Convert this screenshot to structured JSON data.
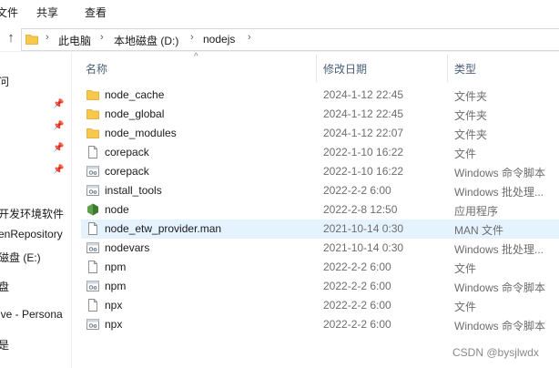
{
  "ribbon": {
    "tabs": [
      "文件",
      "共享",
      "查看"
    ]
  },
  "address": {
    "crumbs": [
      "此电脑",
      "本地磁盘 (D:)",
      "nodejs"
    ]
  },
  "nav": {
    "items": [
      "问",
      "开发环境软件",
      "enRepository",
      "磁盘 (E:)",
      "盘",
      "ive - Persona",
      "是"
    ]
  },
  "columns": {
    "name": "名称",
    "date": "修改日期",
    "type": "类型"
  },
  "files": [
    {
      "name": "node_cache",
      "date": "2024-1-12 22:45",
      "type": "文件夹",
      "icon": "folder-icon"
    },
    {
      "name": "node_global",
      "date": "2024-1-12 22:45",
      "type": "文件夹",
      "icon": "folder-icon"
    },
    {
      "name": "node_modules",
      "date": "2024-1-12 22:07",
      "type": "文件夹",
      "icon": "folder-icon"
    },
    {
      "name": "corepack",
      "date": "2022-1-10 16:22",
      "type": "文件",
      "icon": "file-icon"
    },
    {
      "name": "corepack",
      "date": "2022-1-10 16:22",
      "type": "Windows 命令脚本",
      "icon": "script-icon"
    },
    {
      "name": "install_tools",
      "date": "2022-2-2 6:00",
      "type": "Windows 批处理...",
      "icon": "script-icon"
    },
    {
      "name": "node",
      "date": "2022-2-8 12:50",
      "type": "应用程序",
      "icon": "nodejs-app-icon"
    },
    {
      "name": "node_etw_provider.man",
      "date": "2021-10-14 0:30",
      "type": "MAN 文件",
      "icon": "file-icon"
    },
    {
      "name": "nodevars",
      "date": "2021-10-14 0:30",
      "type": "Windows 批处理...",
      "icon": "script-icon"
    },
    {
      "name": "npm",
      "date": "2022-2-2 6:00",
      "type": "文件",
      "icon": "file-icon"
    },
    {
      "name": "npm",
      "date": "2022-2-2 6:00",
      "type": "Windows 命令脚本",
      "icon": "script-icon"
    },
    {
      "name": "npx",
      "date": "2022-2-2 6:00",
      "type": "文件",
      "icon": "file-icon"
    },
    {
      "name": "npx",
      "date": "2022-2-2 6:00",
      "type": "Windows 命令脚本",
      "icon": "script-icon"
    }
  ],
  "selected_file": "node_etw_provider.man",
  "watermark": "CSDN @bysjlwdx",
  "colors": {
    "folder": "#f8c84a",
    "selection": "#e5f3ff",
    "nodejs": "#5fa04e",
    "header_text": "#4c607a"
  }
}
